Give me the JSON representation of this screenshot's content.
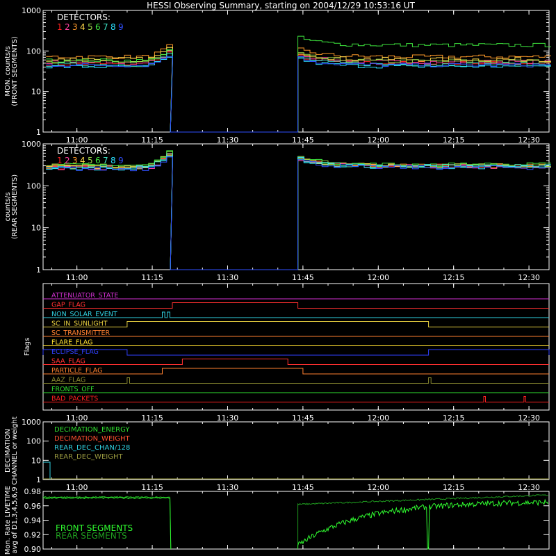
{
  "title": "HESSI Observing Summary, starting on 2004/12/29 10:53:16 UT",
  "detector_colors": [
    "#ff2020",
    "#ff3fa0",
    "#ff9a2a",
    "#ffd84a",
    "#9cd64a",
    "#3ee63e",
    "#3ee6c8",
    "#2ae0ff",
    "#3050ff"
  ],
  "x_ticks": [
    "11:00",
    "11:15",
    "11:30",
    "11:45",
    "12:00",
    "12:15",
    "12:30"
  ],
  "chart_data": [
    {
      "id": "front",
      "type": "line",
      "ylabel_lines": [
        "MON. counts/s",
        "(FRONT SEGMENTS)"
      ],
      "yscale": "log",
      "ylim": [
        1,
        1000
      ],
      "ytick_labels": [
        "1",
        "10",
        "100",
        "1000"
      ],
      "legend_title": "DETECTORS:",
      "legend_items": [
        "1",
        "2",
        "3",
        "4",
        "5",
        "6",
        "7",
        "8",
        "9"
      ],
      "xlim": [
        "10:53:16",
        "12:34:00"
      ],
      "gap": [
        "11:19:00",
        "11:44:00"
      ],
      "series": [
        {
          "detector": "1",
          "before": 48,
          "after": 50
        },
        {
          "detector": "2",
          "before": 52,
          "after": 54
        },
        {
          "detector": "3",
          "before": 72,
          "after": 72
        },
        {
          "detector": "4",
          "before": 63,
          "after": 62
        },
        {
          "detector": "5",
          "before": 55,
          "after": 56
        },
        {
          "detector": "6",
          "before": 58,
          "after": 140
        },
        {
          "detector": "7",
          "before": 46,
          "after": 47
        },
        {
          "detector": "8",
          "before": 41,
          "after": 42
        },
        {
          "detector": "9",
          "before": 45,
          "after": 45
        }
      ]
    },
    {
      "id": "rear",
      "type": "line",
      "ylabel_lines": [
        "counts/s",
        "(REAR SEGMENTS)"
      ],
      "yscale": "log",
      "ylim": [
        1,
        1000
      ],
      "ytick_labels": [
        "1",
        "10",
        "100",
        "1000"
      ],
      "legend_title": "DETECTORS:",
      "legend_items": [
        "1",
        "2",
        "3",
        "4",
        "5",
        "6",
        "7",
        "8",
        "9"
      ],
      "xlim": [
        "10:53:16",
        "12:34:00"
      ],
      "gap": [
        "11:19:00",
        "11:44:00"
      ],
      "series": [
        {
          "detector": "1",
          "before": 280,
          "after": 300
        },
        {
          "detector": "2",
          "before": 270,
          "after": 290
        },
        {
          "detector": "3",
          "before": 290,
          "after": 300
        },
        {
          "detector": "4",
          "before": 285,
          "after": 305
        },
        {
          "detector": "5",
          "before": 300,
          "after": 310
        },
        {
          "detector": "6",
          "before": 310,
          "after": 320
        },
        {
          "detector": "7",
          "before": 275,
          "after": 295
        },
        {
          "detector": "8",
          "before": 265,
          "after": 285
        },
        {
          "detector": "9",
          "before": 255,
          "after": 275
        }
      ]
    },
    {
      "id": "flags",
      "type": "step",
      "ylabel": "Flags",
      "xlim": [
        "10:53:16",
        "12:34:00"
      ],
      "flags": [
        {
          "label": "ATTENUATOR_STATE",
          "color": "#d030d0",
          "on": []
        },
        {
          "label": "GAP_FLAG",
          "color": "#ff3030",
          "on": [
            [
              "11:19:00",
              "11:44:00"
            ]
          ]
        },
        {
          "label": "NON_SOLAR_EVENT",
          "color": "#30d0e0",
          "on": [
            [
              "11:17:00",
              "11:17:30"
            ],
            [
              "11:18:00",
              "11:18:30"
            ]
          ]
        },
        {
          "label": "SC_IN_SUNLIGHT",
          "color": "#e8d040",
          "on": [
            [
              "11:10:00",
              "12:10:00"
            ]
          ]
        },
        {
          "label": "SC_TRANSMITTER",
          "color": "#ff8030",
          "on": []
        },
        {
          "label": "FLARE_FLAG",
          "color": "#ffe030",
          "on": []
        },
        {
          "label": "ECLIPSE_FLAG",
          "color": "#3040ff",
          "on": [
            [
              "10:53:16",
              "11:10:00"
            ],
            [
              "12:10:00",
              "12:34:00"
            ]
          ]
        },
        {
          "label": "SAA_FLAG",
          "color": "#ff3030",
          "on": [
            [
              "11:21:00",
              "11:42:00"
            ]
          ]
        },
        {
          "label": "PARTICLE_FLAG",
          "color": "#ff8030",
          "on": [
            [
              "11:17:00",
              "11:45:00"
            ]
          ]
        },
        {
          "label": "AAZ_FLAG",
          "color": "#8a8a30",
          "on": [
            [
              "11:10:00",
              "11:10:30"
            ],
            [
              "12:10:00",
              "12:10:30"
            ]
          ]
        },
        {
          "label": "FRONTS_OFF",
          "color": "#30e030",
          "on": []
        },
        {
          "label": "BAD_PACKETS",
          "color": "#ff2020",
          "on": [
            [
              "12:21:00",
              "12:21:20"
            ],
            [
              "12:29:00",
              "12:29:20"
            ]
          ]
        }
      ]
    },
    {
      "id": "decimation",
      "type": "line",
      "ylabel_lines": [
        "DECIMATION",
        "CHANNEL or weight"
      ],
      "yscale": "log",
      "ylim": [
        1,
        1000
      ],
      "ytick_labels": [
        "1",
        "10",
        "100",
        "1000"
      ],
      "xlim": [
        "10:53:16",
        "12:34:00"
      ],
      "legend": [
        {
          "label": "DECIMATION_ENERGY",
          "color": "#30e030"
        },
        {
          "label": "DECIMATION_WEIGHT",
          "color": "#ff5030"
        },
        {
          "label": "REAR_DEC_CHAN/128",
          "color": "#30d0e0"
        },
        {
          "label": "REAR_DEC_WEIGHT",
          "color": "#9a9a40"
        }
      ]
    },
    {
      "id": "livetime",
      "type": "line",
      "ylabel_lines": [
        "Mon. Rate LIVETIME",
        "avg of D1,3,4,5,6,9"
      ],
      "yscale": "linear",
      "ylim": [
        0.9,
        0.98
      ],
      "ytick_labels": [
        "0.90",
        "0.92",
        "0.94",
        "0.96",
        "0.98"
      ],
      "xlim": [
        "10:53:16",
        "12:34:00"
      ],
      "series": [
        {
          "name": "FRONT SEGMENTS",
          "color": "#30ff30",
          "before": 0.971,
          "after_start": 0.905,
          "after_end": 0.966
        },
        {
          "name": "REAR SEGMENTS",
          "color": "#20a020",
          "before": 0.972,
          "after_start": 0.962,
          "after_end": 0.975
        }
      ]
    }
  ]
}
